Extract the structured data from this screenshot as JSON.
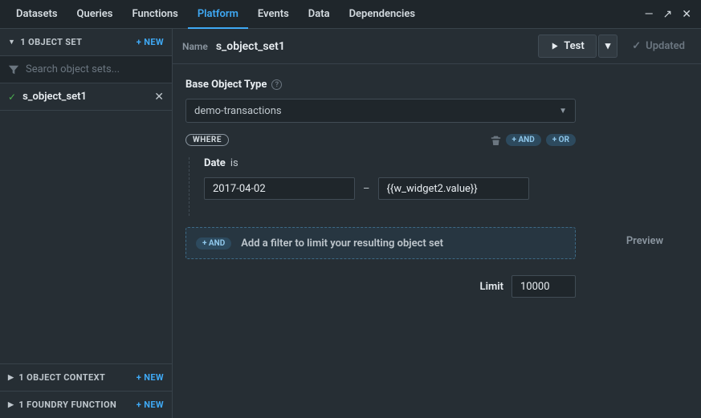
{
  "tabs": {
    "items": [
      "Datasets",
      "Queries",
      "Functions",
      "Platform",
      "Events",
      "Data",
      "Dependencies"
    ],
    "active": 3
  },
  "window": {
    "minimize": "—",
    "expand": "↗",
    "close": "✕"
  },
  "sidebar": {
    "objectSet": {
      "label": "1 OBJECT SET",
      "new": "+ NEW"
    },
    "search": {
      "placeholder": "Search object sets..."
    },
    "items": [
      {
        "name": "s_object_set1",
        "ok": true
      }
    ],
    "objectContext": {
      "label": "1 OBJECT CONTEXT",
      "new": "+ NEW"
    },
    "foundryFunction": {
      "label": "1 FOUNDRY FUNCTION",
      "new": "+ NEW"
    }
  },
  "toolbar": {
    "nameLabel": "Name",
    "nameValue": "s_object_set1",
    "test": "Test",
    "updated": "Updated"
  },
  "editor": {
    "baseObjectTypeLabel": "Base Object Type",
    "baseObjectTypeValue": "demo-transactions",
    "where": "WHERE",
    "andPill": "+ AND",
    "orPill": "+ OR",
    "filter": {
      "field": "Date",
      "op": "is",
      "from": "2017-04-02",
      "to": "{{w_widget2.value}}"
    },
    "addFilter": {
      "pill": "+ AND",
      "hint": "Add a filter to limit your resulting object set"
    },
    "limitLabel": "Limit",
    "limitValue": "10000"
  },
  "preview": {
    "label": "Preview"
  }
}
